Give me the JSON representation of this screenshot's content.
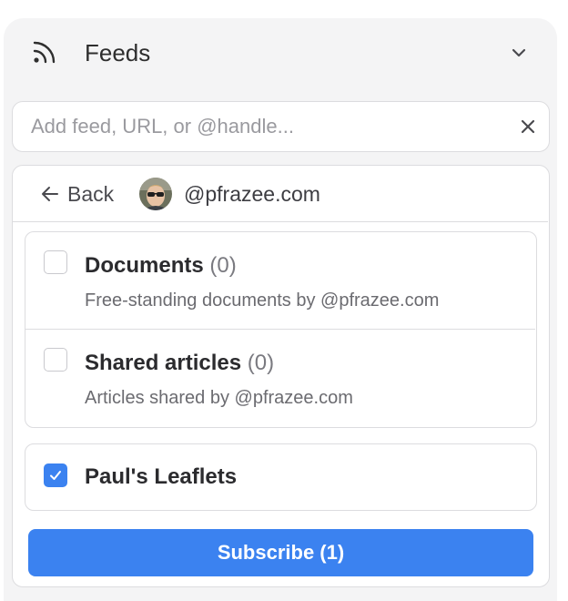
{
  "header": {
    "icon": "rss-feed-icon",
    "title": "Feeds",
    "collapse_icon": "chevron-down-icon"
  },
  "search": {
    "placeholder": "Add feed, URL, or @handle...",
    "value": "",
    "clear_icon": "close-icon"
  },
  "card": {
    "back_label": "Back",
    "back_icon": "arrow-left-icon",
    "handle": "@pfrazee.com"
  },
  "items": [
    {
      "title": "Documents",
      "count": "(0)",
      "description": "Free-standing documents by @pfrazee.com",
      "checked": false
    },
    {
      "title": "Shared articles",
      "count": "(0)",
      "description": "Articles shared by @pfrazee.com",
      "checked": false
    },
    {
      "title": "Paul's Leaflets",
      "count": "",
      "description": "",
      "checked": true
    }
  ],
  "subscribe_label": "Subscribe (1)",
  "colors": {
    "accent": "#3b82f0",
    "panel_bg": "#f4f4f5",
    "border": "#dcdcdf"
  }
}
